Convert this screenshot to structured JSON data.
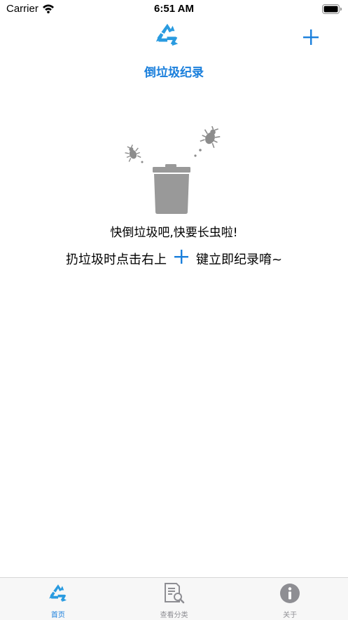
{
  "status_bar": {
    "carrier": "Carrier",
    "time": "6:51 AM"
  },
  "header": {
    "title": "倒垃圾纪录",
    "add_icon": "plus-icon",
    "logo_icon": "recycle-icon"
  },
  "empty_state": {
    "line1": "快倒垃圾吧,快要长虫啦!",
    "line2_before": "扔垃圾时点击右上",
    "line2_after": "键立即纪录唷~"
  },
  "tab_bar": {
    "tabs": [
      {
        "label": "首页",
        "icon": "recycle-icon",
        "active": true
      },
      {
        "label": "查看分类",
        "icon": "document-search-icon",
        "active": false
      },
      {
        "label": "关于",
        "icon": "info-icon",
        "active": false
      }
    ]
  },
  "colors": {
    "accent": "#1a7fdc",
    "inactive": "#8e8e93",
    "illustration_gray": "#9a9a9a"
  }
}
